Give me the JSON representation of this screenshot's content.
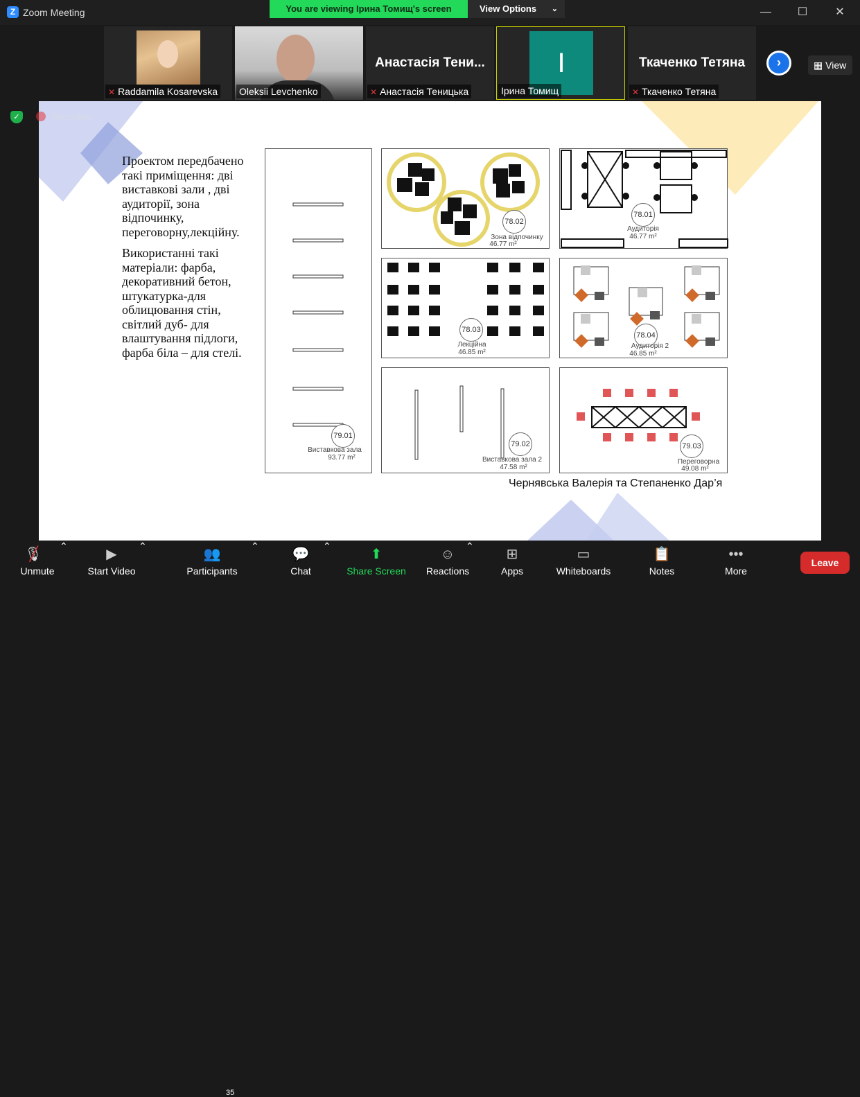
{
  "window": {
    "app_title": "Zoom Meeting",
    "app_icon": "zoom-icon"
  },
  "banner": {
    "viewing_text": "You are viewing Ірина Томищ's screen",
    "view_options_label": "View Options"
  },
  "gallery": {
    "participants": [
      {
        "name": "Raddamila Kosarevska",
        "muted": true
      },
      {
        "name": "Oleksii Levchenko",
        "muted": false
      },
      {
        "name": "Анастасія Теницька",
        "display_big": "Анастасія Тени...",
        "muted": true
      },
      {
        "name": "Ірина Томищ",
        "avatar_letter": "І",
        "muted": false,
        "active": true
      },
      {
        "name": "Ткаченко Тетяна",
        "display_big": "Ткаченко Тетяна",
        "muted": true
      }
    ],
    "view_label": "View"
  },
  "status": {
    "recording_label": "Recording"
  },
  "slide": {
    "paragraph1": "Проектом передбачено такі приміщення:  дві виставкові зали , дві аудиторії, зона відпочинку, переговорну,лекційну.",
    "paragraph2": "Використанні такі матеріали: фарба, декоративний бетон, штукатурка-для облицювання стін, світлий дуб- для влаштування підлоги, фарба біла – для стелі.",
    "authors": "Чернявська Валерія та Степаненко Дар’я",
    "rooms": [
      {
        "number": "79.01",
        "name": "Виставкова зала",
        "area": "93.77 m²"
      },
      {
        "number": "78.02",
        "name": "Зона відпочинку",
        "area": "46.77 m²"
      },
      {
        "number": "78.01",
        "name": "Аудиторія",
        "area": "46.77 m²"
      },
      {
        "number": "78.03",
        "name": "Лекційна",
        "area": "46.85 m²"
      },
      {
        "number": "78.04",
        "name": "Аудиторія 2",
        "area": "46.85 m²"
      },
      {
        "number": "79.02",
        "name": "Виставкова зала 2",
        "area": "47.58 m²"
      },
      {
        "number": "79.03",
        "name": "Переговорна",
        "area": "49.08 m²"
      }
    ]
  },
  "toolbar": {
    "unmute": "Unmute",
    "start_video": "Start Video",
    "participants": "Participants",
    "participants_count": "35",
    "chat": "Chat",
    "share_screen": "Share Screen",
    "reactions": "Reactions",
    "apps": "Apps",
    "whiteboards": "Whiteboards",
    "notes": "Notes",
    "more": "More",
    "leave": "Leave"
  },
  "colors": {
    "share_green": "#23d959",
    "leave_red": "#d62b2b",
    "mute_red": "#e0383e",
    "avatar_teal": "#0e8a7c",
    "accent_blue": "#1a73e8"
  }
}
